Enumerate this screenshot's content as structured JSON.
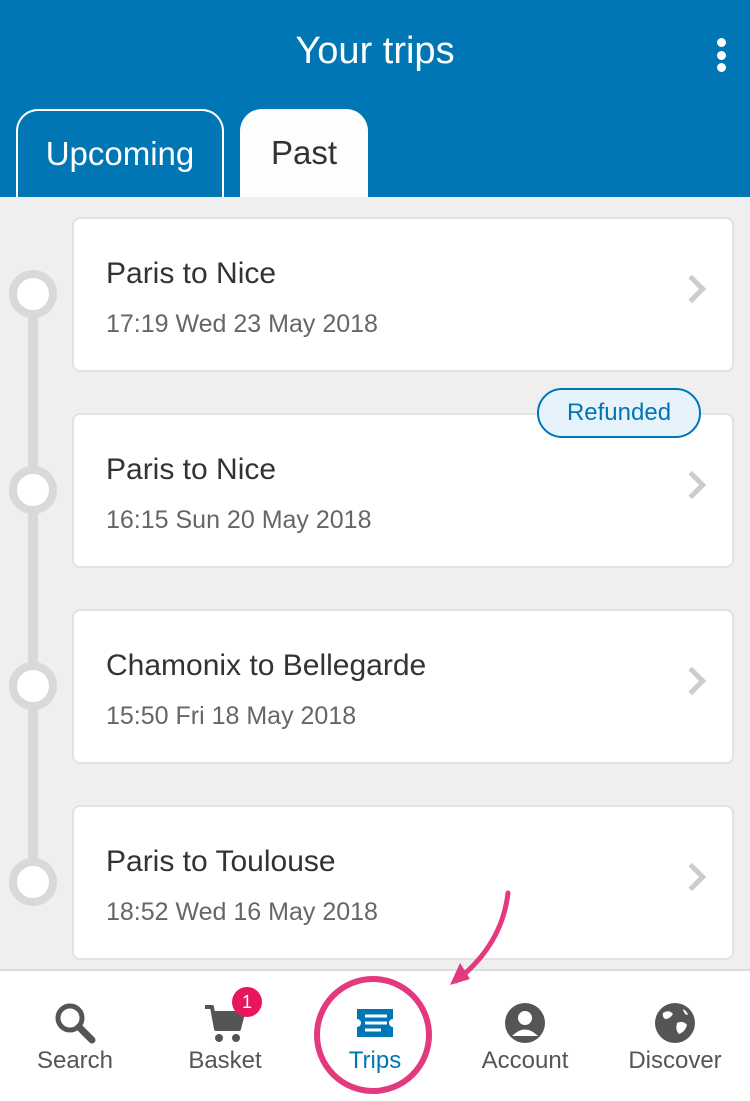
{
  "header": {
    "title": "Your trips"
  },
  "tabs": {
    "upcoming": "Upcoming",
    "past": "Past"
  },
  "trips": [
    {
      "route": "Paris to Nice",
      "datetime": "17:19 Wed 23 May 2018"
    },
    {
      "route": "Paris to Nice",
      "datetime": "16:15 Sun 20 May 2018",
      "badge": "Refunded"
    },
    {
      "route": "Chamonix to Bellegarde",
      "datetime": "15:50 Fri 18 May 2018"
    },
    {
      "route": "Paris to Toulouse",
      "datetime": "18:52 Wed 16 May 2018"
    }
  ],
  "tabbar": {
    "items": [
      {
        "label": "Search",
        "icon": "search-icon"
      },
      {
        "label": "Basket",
        "icon": "cart-icon",
        "count": "1"
      },
      {
        "label": "Trips",
        "icon": "ticket-icon"
      },
      {
        "label": "Account",
        "icon": "account-icon"
      },
      {
        "label": "Discover",
        "icon": "globe-icon"
      }
    ]
  },
  "colors": {
    "brand": "#0076b5",
    "highlight": "#e3397f",
    "badge_red": "#e8175d"
  }
}
